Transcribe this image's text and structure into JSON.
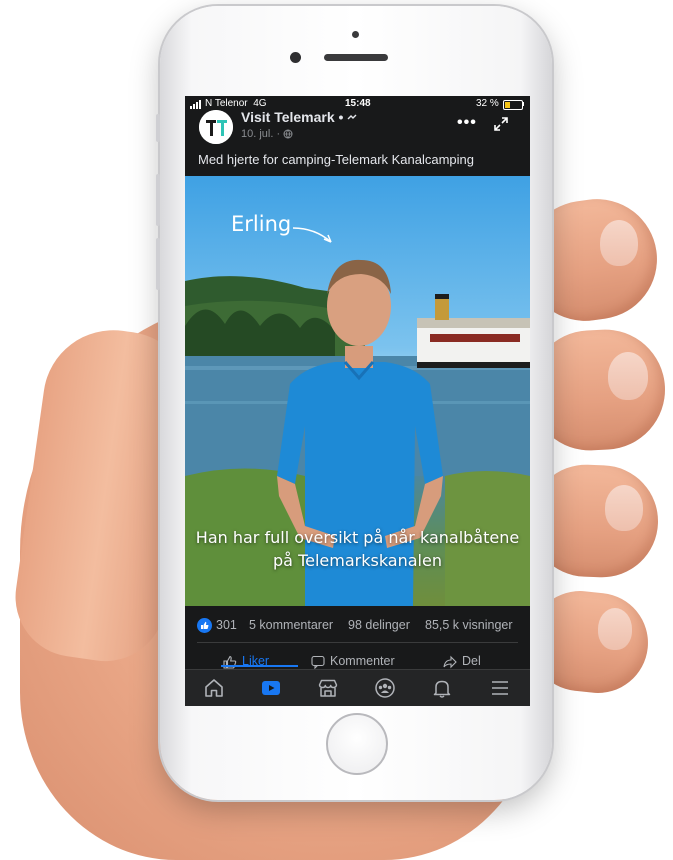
{
  "status_bar": {
    "carrier": "N Telenor",
    "network": "4G",
    "time": "15:48",
    "battery": "32 %",
    "battery_level": 0.32
  },
  "post": {
    "page_name": "Visit Telemark • ",
    "date": "10. jul. · ",
    "caption": "Med hjerte for camping-Telemark Kanalcamping"
  },
  "video": {
    "name_tag": "Erling",
    "subtitle_line1": "Han har full oversikt på når kanalbåtene",
    "subtitle_line2": "på Telemarkskanalen"
  },
  "stats": {
    "likes": "301",
    "comments": "5 kommentarer",
    "shares": "98 delinger",
    "views": "85,5 k visninger"
  },
  "actions": {
    "like": "Liker",
    "comment": "Kommenter",
    "share": "Del"
  },
  "bottom_nav": [
    {
      "icon": "home-icon"
    },
    {
      "icon": "watch-icon",
      "active": true
    },
    {
      "icon": "marketplace-icon"
    },
    {
      "icon": "groups-icon"
    },
    {
      "icon": "notifications-icon"
    },
    {
      "icon": "menu-icon"
    }
  ],
  "colors": {
    "accent": "#1877f2",
    "screen_bg": "#18191a",
    "nav_bg": "#242526",
    "shirt": "#1e8ad6"
  }
}
